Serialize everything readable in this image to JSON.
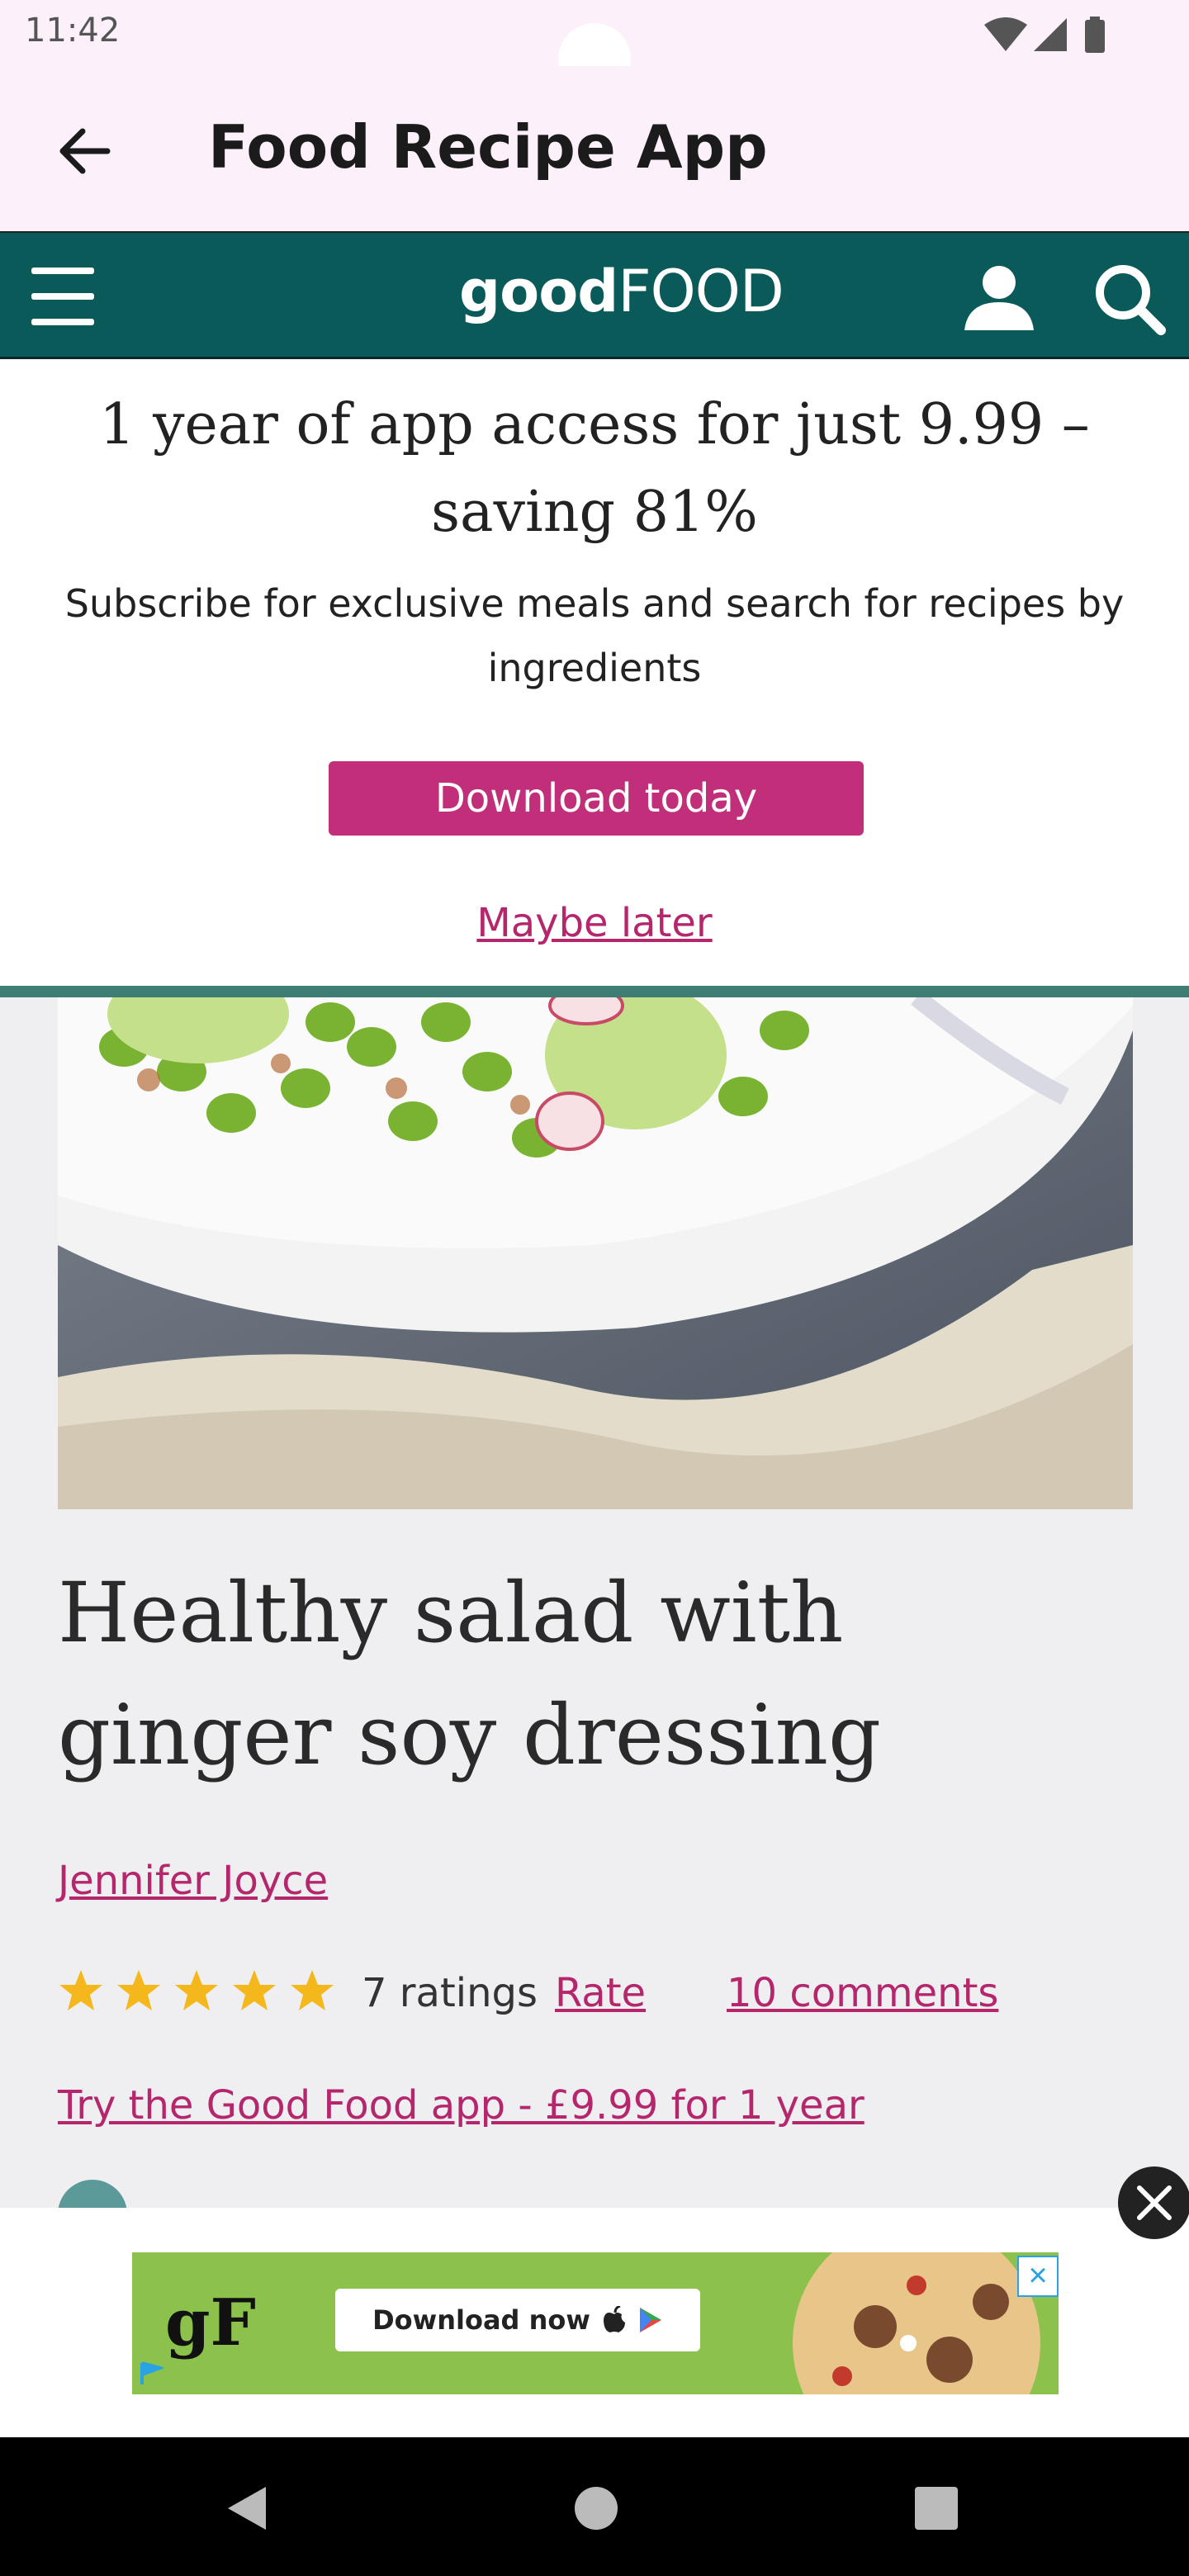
{
  "status_bar": {
    "time": "11:42"
  },
  "app_bar": {
    "title": "Food Recipe App"
  },
  "site_header": {
    "logo_good": "good",
    "logo_food": "FOOD"
  },
  "promo": {
    "headline": "1 year of app access for just 9.99 – saving 81%",
    "subtext": "Subscribe for exclusive meals and search for recipes by ingredients",
    "download_label": "Download today",
    "maybe_later_label": "Maybe later"
  },
  "recipe": {
    "title": "Healthy salad with ginger soy dressing",
    "author": "Jennifer Joyce",
    "rating_stars": 5,
    "ratings_text": "7 ratings",
    "rate_label": "Rate",
    "comments_label": "10 comments",
    "app_offer_link": "Try the Good Food app - £9.99 for 1 year"
  },
  "ad": {
    "logo_text": "gF",
    "button_label": "Download now"
  },
  "colors": {
    "brand_teal": "#0b5a5a",
    "accent_magenta": "#c12e7a",
    "link_magenta": "#b5276d",
    "star_gold": "#f5b81c",
    "ad_green": "#8cc24b"
  },
  "icons": [
    "back-arrow-icon",
    "menu-icon",
    "user-icon",
    "search-icon",
    "star-icon",
    "close-icon",
    "apple-icon",
    "play-store-icon",
    "nav-back-icon",
    "nav-home-icon",
    "nav-recents-icon"
  ]
}
